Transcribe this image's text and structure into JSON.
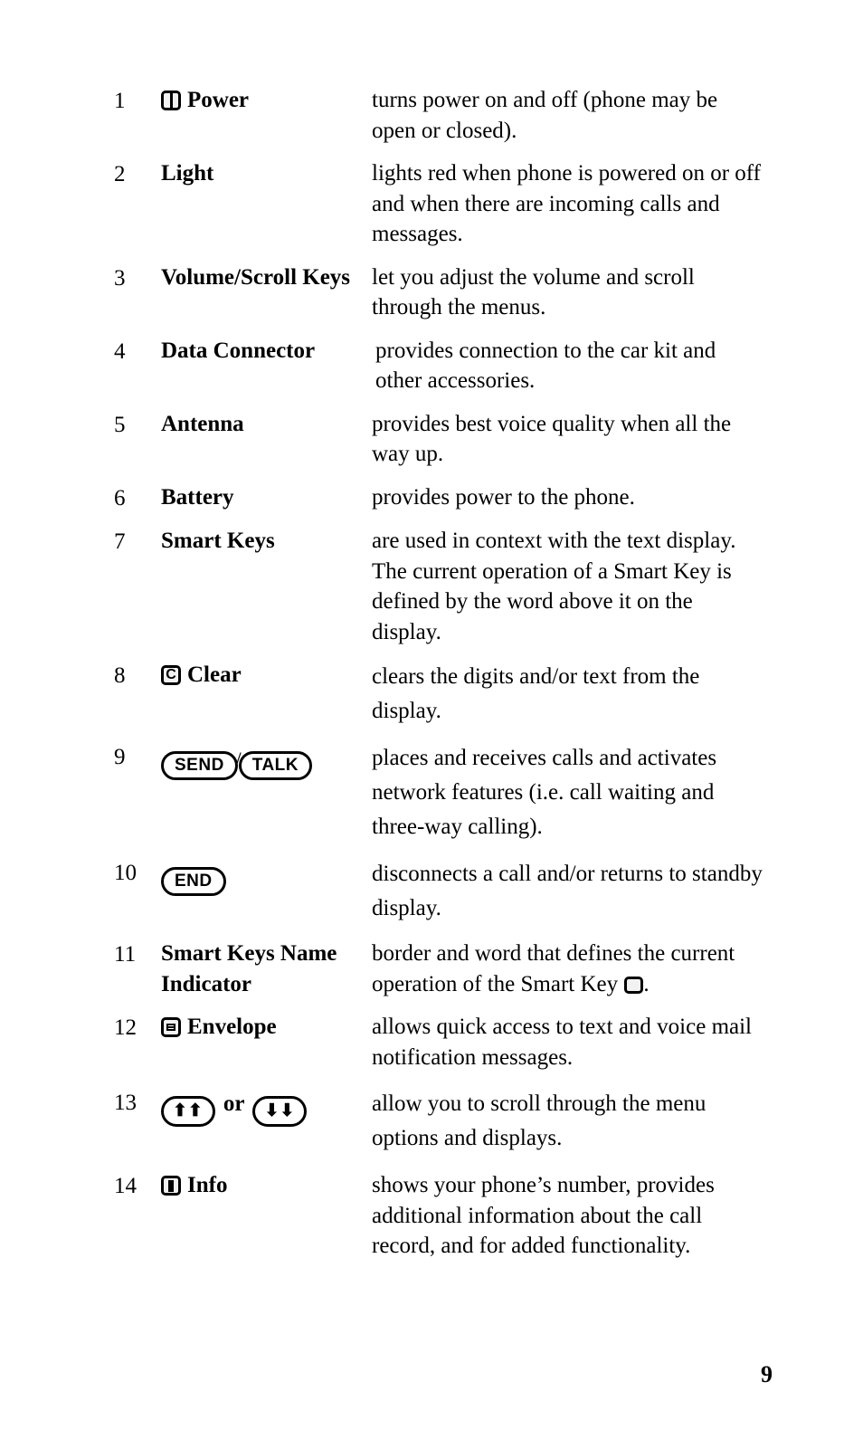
{
  "document": {
    "page_number": "9",
    "type": "phone-feature-legend"
  },
  "legend": {
    "items": [
      {
        "num": "1",
        "icon": "power-key-icon",
        "label": "Power",
        "description": "turns power on and off (phone may be open or closed)."
      },
      {
        "num": "2",
        "icon": null,
        "label": "Light",
        "description": "lights red when phone is powered on or off and when there are incoming calls and messages."
      },
      {
        "num": "3",
        "icon": null,
        "label": "Volume/Scroll Keys",
        "description": "let you adjust the volume and scroll through the menus."
      },
      {
        "num": "4",
        "icon": null,
        "label": "Data Connector",
        "description": "provides connection to the car kit and other accessories."
      },
      {
        "num": "5",
        "icon": null,
        "label": "Antenna",
        "description": "provides best voice quality when all the way up."
      },
      {
        "num": "6",
        "icon": null,
        "label": "Battery",
        "description": "provides power to the phone."
      },
      {
        "num": "7",
        "icon": null,
        "label": "Smart Keys",
        "description": "are used in context with the text display. The current operation of a Smart Key is defined by the word above it on the display."
      },
      {
        "num": "8",
        "icon": "clear-key-icon",
        "icon_glyph": "C",
        "label": "Clear",
        "description": "clears the digits and/or text from the display."
      },
      {
        "num": "9",
        "icon": "send-talk-key-icon",
        "send_label": "SEND",
        "separator": "/",
        "talk_label": "TALK",
        "label": "",
        "description": "places and receives calls and activates network features (i.e. call waiting and three-way calling)."
      },
      {
        "num": "10",
        "icon": "end-key-icon",
        "end_label": "END",
        "label": "",
        "description": "disconnects a call and/or returns to standby display."
      },
      {
        "num": "11",
        "icon": null,
        "label": "Smart Keys Name Indicator",
        "description_pre": "border and word that defines the current operation of the Smart Key",
        "description_post": ".",
        "trailing_icon": "smart-key-icon"
      },
      {
        "num": "12",
        "icon": "envelope-key-icon",
        "label": "Envelope",
        "description": "allows quick access to text and voice mail notification messages."
      },
      {
        "num": "13",
        "icon": "scroll-up-key-icon",
        "icon_2": "scroll-down-key-icon",
        "up_glyphs": "⬆⬆",
        "down_glyphs": "⬇⬇",
        "or_word": "or",
        "label": "",
        "description": "allow you to scroll through the menu options and displays."
      },
      {
        "num": "14",
        "icon": "info-key-icon",
        "label": "Info",
        "description": "shows your phone’s number, provides additional information about the call record, and for added functionality."
      }
    ]
  }
}
